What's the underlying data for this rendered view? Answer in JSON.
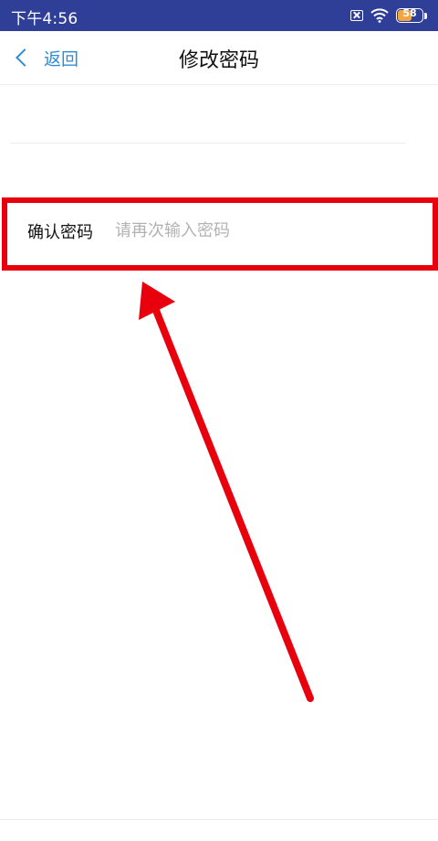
{
  "status_bar": {
    "time": "下午4:56",
    "battery_level": "58",
    "battery_fraction": 0.58
  },
  "nav": {
    "back_label": "返回",
    "title": "修改密码"
  },
  "confirm_field": {
    "label": "确认密码",
    "placeholder": "请再次输入密码",
    "value": ""
  },
  "colors": {
    "status_bar": "#2f3f98",
    "accent": "#2d8cd8",
    "highlight": "#e8000d",
    "placeholder": "#b2b2b2"
  },
  "icons": [
    "sim-x-icon",
    "wifi-icon",
    "battery-icon",
    "back-chevron-icon"
  ]
}
